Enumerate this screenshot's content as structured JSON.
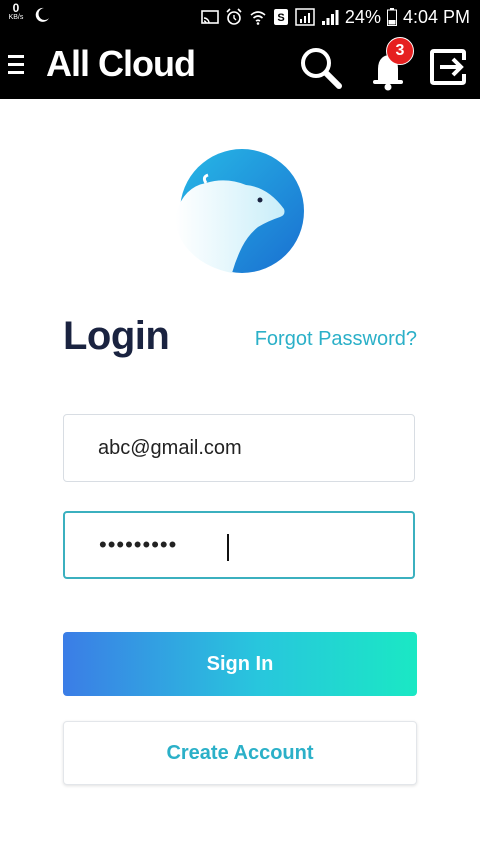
{
  "status_bar": {
    "network_speed_value": "0",
    "network_speed_unit": "KB/s",
    "battery_percent": "24%",
    "time": "4:04 PM"
  },
  "app_bar": {
    "title": "All Cloud",
    "notification_count": "3",
    "icons": [
      "menu-icon",
      "search-icon",
      "bell-icon",
      "exit-icon"
    ]
  },
  "login": {
    "title": "Login",
    "forgot_password": "Forgot Password?",
    "email_value": "abc@gmail.com",
    "password_mask": "•••••••••",
    "sign_in_label": "Sign In",
    "create_account_label": "Create Account"
  },
  "colors": {
    "accent": "#2bb0c8",
    "title": "#1a2340",
    "gradient_start": "#3b7de6",
    "gradient_end": "#1ae8c4",
    "badge": "#e62020"
  }
}
